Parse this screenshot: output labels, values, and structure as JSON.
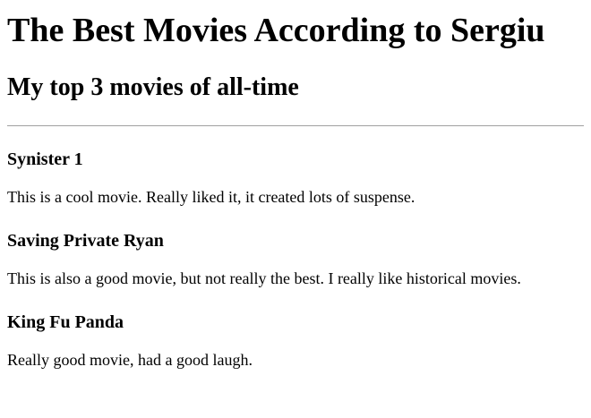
{
  "page": {
    "title": "The Best Movies According to Sergiu",
    "subtitle": "My top 3 movies of all-time"
  },
  "movies": [
    {
      "title": "Synister 1",
      "description": "This is a cool movie. Really liked it, it created lots of suspense."
    },
    {
      "title": "Saving Private Ryan",
      "description": "This is also a good movie, but not really the best. I really like historical movies."
    },
    {
      "title": "King Fu Panda",
      "description": "Really good movie, had a good laugh."
    }
  ]
}
